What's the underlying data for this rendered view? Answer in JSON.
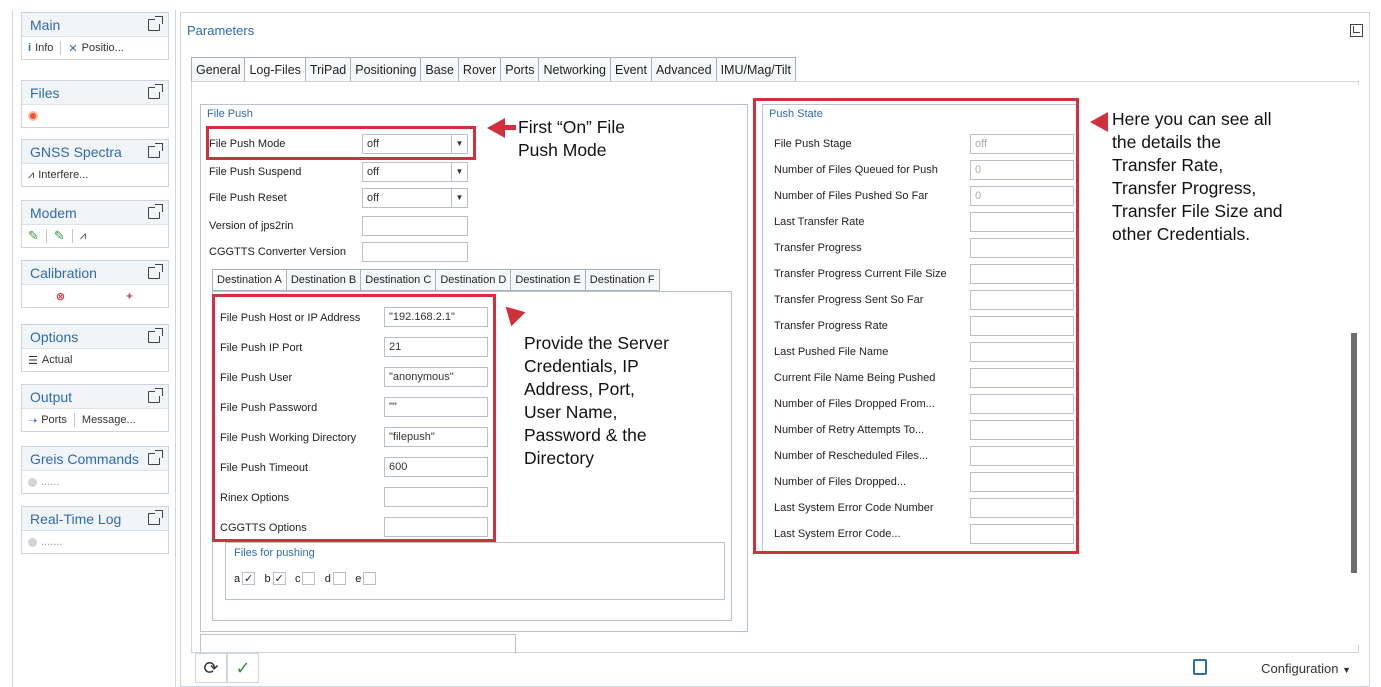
{
  "sidebar": {
    "panels": [
      {
        "title": "Main",
        "items": [
          "Info",
          "Positio..."
        ]
      },
      {
        "title": "Files"
      },
      {
        "title": "GNSS Spectra",
        "items": [
          "Interfere..."
        ]
      },
      {
        "title": "Modem"
      },
      {
        "title": "Calibration"
      },
      {
        "title": "Options",
        "items": [
          "Actual"
        ]
      },
      {
        "title": "Output",
        "items": [
          "Ports",
          "Message..."
        ]
      },
      {
        "title": "Greis Commands",
        "items": [
          "......"
        ]
      },
      {
        "title": "Real-Time Log",
        "items": [
          "......."
        ]
      }
    ]
  },
  "params": {
    "title": "Parameters",
    "tabs": [
      "General",
      "Log-Files",
      "TriPad",
      "Positioning",
      "Base",
      "Rover",
      "Ports",
      "Networking",
      "Event",
      "Advanced",
      "IMU/Mag/Tilt"
    ],
    "active_tab": "Log-Files"
  },
  "file_push": {
    "group_title": "File Push",
    "mode": {
      "label": "File Push Mode",
      "value": "off"
    },
    "suspend": {
      "label": "File Push Suspend",
      "value": "off"
    },
    "reset": {
      "label": "File Push Reset",
      "value": "off"
    },
    "jps2rin": {
      "label": "Version of jps2rin",
      "value": ""
    },
    "cggtts": {
      "label": "CGGTTS Converter Version",
      "value": ""
    },
    "dest_tabs": [
      "Destination A",
      "Destination B",
      "Destination C",
      "Destination D",
      "Destination E",
      "Destination F"
    ],
    "dest_fields": [
      {
        "label": "File Push Host or IP Address",
        "value": "\"192.168.2.1\""
      },
      {
        "label": "File Push IP Port",
        "value": "21"
      },
      {
        "label": "File Push User",
        "value": "\"anonymous\""
      },
      {
        "label": "File Push Password",
        "value": "\"\""
      },
      {
        "label": "File Push Working Directory",
        "value": "\"filepush\""
      },
      {
        "label": "File Push Timeout",
        "value": "600"
      },
      {
        "label": "Rinex Options",
        "value": ""
      },
      {
        "label": "CGGTTS Options",
        "value": ""
      }
    ],
    "files_title": "Files for pushing",
    "files": [
      {
        "label": "a",
        "checked": "✓"
      },
      {
        "label": "b",
        "checked": "✓"
      },
      {
        "label": "c",
        "checked": ""
      },
      {
        "label": "d",
        "checked": ""
      },
      {
        "label": "e",
        "checked": ""
      }
    ]
  },
  "push_state": {
    "group_title": "Push State",
    "rows": [
      {
        "label": "File Push Stage",
        "value": "off"
      },
      {
        "label": "Number of Files Queued for Push",
        "value": "0"
      },
      {
        "label": "Number of Files Pushed So Far",
        "value": "0"
      },
      {
        "label": "Last Transfer Rate",
        "value": ""
      },
      {
        "label": "Transfer Progress",
        "value": ""
      },
      {
        "label": "Transfer Progress Current File Size",
        "value": ""
      },
      {
        "label": "Transfer Progress Sent So Far",
        "value": ""
      },
      {
        "label": "Transfer Progress Rate",
        "value": ""
      },
      {
        "label": "Last Pushed File Name",
        "value": ""
      },
      {
        "label": "Current File Name Being Pushed",
        "value": ""
      },
      {
        "label": "Number of Files Dropped From...",
        "value": ""
      },
      {
        "label": "Number of Retry Attempts To...",
        "value": ""
      },
      {
        "label": "Number of Rescheduled Files...",
        "value": ""
      },
      {
        "label": "Number of Files Dropped...",
        "value": ""
      },
      {
        "label": "Last System Error Code Number",
        "value": ""
      },
      {
        "label": "Last System Error Code...",
        "value": ""
      }
    ]
  },
  "annotations": {
    "mode_note": [
      "First “On” File",
      "Push Mode"
    ],
    "server_note": [
      "Provide the Server",
      "Credentials, IP",
      "Address, Port,",
      "User Name,",
      "Password & the",
      "Directory"
    ],
    "state_note": [
      "Here you can see all",
      "the details the",
      "Transfer Rate,",
      "Transfer Progress,",
      "Transfer File Size and",
      "other Credentials."
    ],
    "color": "#d0313d"
  },
  "bottom_bar": {
    "configuration_label": "Configuration"
  }
}
